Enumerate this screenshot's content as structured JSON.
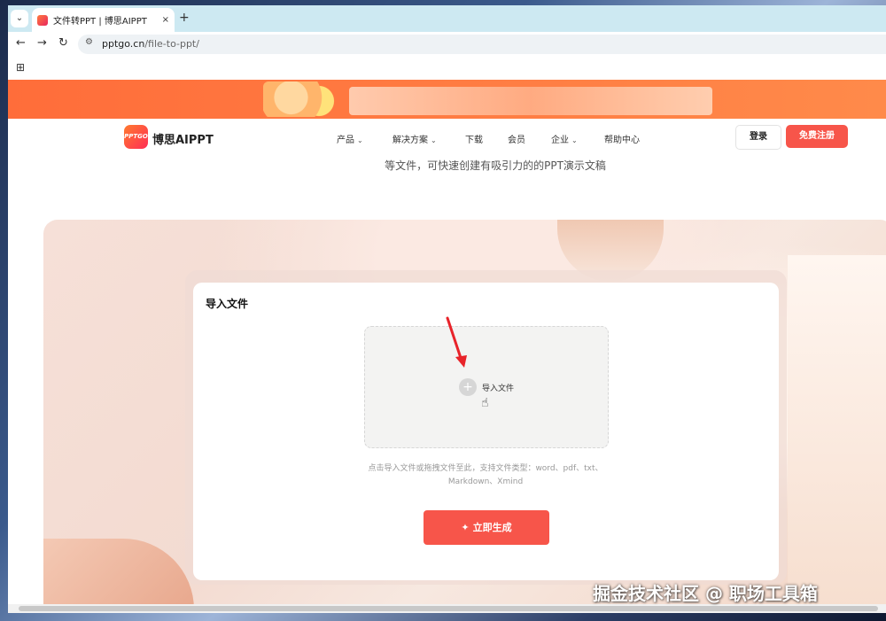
{
  "browser": {
    "tab_title": "文件转PPT | 博思AIPPT",
    "tab_close": "×",
    "new_tab": "+",
    "tab_list": "⌄",
    "back": "←",
    "forward": "→",
    "reload": "↻",
    "url_host": "pptgo.cn",
    "url_path": "/file-to-ppt/",
    "apps_icon": "⊞"
  },
  "site": {
    "logo_mark": "PPTGO",
    "brand": "博思AIPPT",
    "menu": [
      {
        "label": "产品",
        "has_dropdown": true
      },
      {
        "label": "解决方案",
        "has_dropdown": true
      },
      {
        "label": "下载",
        "has_dropdown": false
      },
      {
        "label": "会员",
        "has_dropdown": false
      },
      {
        "label": "企业",
        "has_dropdown": true
      },
      {
        "label": "帮助中心",
        "has_dropdown": false
      }
    ],
    "login": "登录",
    "register": "免费注册",
    "accent_color": "#f7554a"
  },
  "main": {
    "subtitle": "等文件，可快速创建有吸引力的的PPT演示文稿",
    "card_title": "导入文件",
    "dropzone_label": "导入文件",
    "plus": "+",
    "hint_line1": "点击导入文件或拖拽文件至此，支持文件类型：word、pdf、txt、",
    "hint_line2": "Markdown、Xmind",
    "generate": "立即生成",
    "spark": "✦"
  },
  "watermark": "掘金技术社区 @ 职场工具箱"
}
